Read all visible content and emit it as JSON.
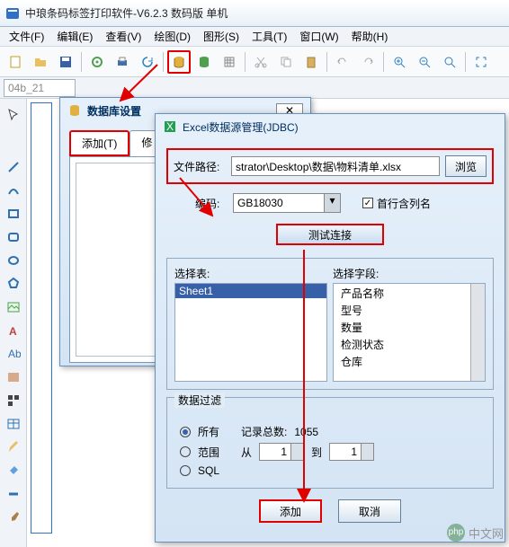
{
  "app": {
    "title": "中琅条码标签打印软件-V6.2.3 数码版 单机"
  },
  "menu": {
    "file": "文件(F)",
    "edit": "编辑(E)",
    "view": "查看(V)",
    "draw": "绘图(D)",
    "shape": "图形(S)",
    "tool": "工具(T)",
    "window": "窗口(W)",
    "help": "帮助(H)"
  },
  "namebox": "04b_21",
  "dbdlg": {
    "title": "数据库设置",
    "tab_add": "添加(T)",
    "tab_mod": "修"
  },
  "excel": {
    "title": "Excel数据源管理(JDBC)",
    "file_label": "文件路径:",
    "file_path": "strator\\Desktop\\数据\\物料清单.xlsx",
    "browse": "浏览",
    "enc_label": "编码:",
    "enc_value": "GB18030",
    "first_row": "首行含列名",
    "test_btn": "测试连接",
    "sel_table_label": "选择表:",
    "sel_table_items": [
      "Sheet1"
    ],
    "sel_field_label": "选择字段:",
    "sel_field_items": [
      "产品名称",
      "型号",
      "数量",
      "检测状态",
      "仓库"
    ],
    "filter_title": "数据过滤",
    "radio_all": "所有",
    "total_label": "记录总数:",
    "total_value": "1055",
    "radio_range": "范围",
    "from_label": "从",
    "from_value": "1",
    "to_label": "到",
    "to_value": "1",
    "radio_sql": "SQL",
    "add_btn": "添加",
    "cancel_btn": "取消"
  },
  "watermark": "中文网",
  "colors": {
    "annot": "#e00000",
    "accent": "#3860a8"
  }
}
